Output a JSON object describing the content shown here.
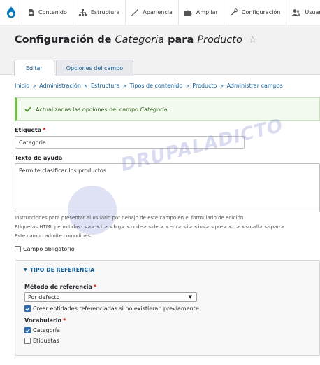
{
  "toolbar": {
    "items": [
      {
        "label": "Contenido",
        "icon": "file-icon"
      },
      {
        "label": "Estructura",
        "icon": "sitemap-icon"
      },
      {
        "label": "Apariencia",
        "icon": "paintbrush-icon"
      },
      {
        "label": "Ampliar",
        "icon": "puzzle-icon"
      },
      {
        "label": "Configuración",
        "icon": "wrench-icon"
      },
      {
        "label": "Usuario",
        "icon": "people-icon"
      }
    ],
    "brand_color": "#0678be"
  },
  "header": {
    "title_prefix": "Configuración de",
    "title_field": "Categoria",
    "title_middle": "para",
    "title_entity": "Producto",
    "star": "☆",
    "tabs": [
      {
        "label": "Editar",
        "active": true
      },
      {
        "label": "Opciones del campo",
        "active": false
      }
    ]
  },
  "breadcrumb": {
    "items": [
      "Inicio",
      "Administración",
      "Estructura",
      "Tipos de contenido",
      "Producto",
      "Administrar campos"
    ],
    "separator": "»"
  },
  "status": {
    "text": "Actualizadas las opciones del campo",
    "field": "Categoria",
    "suffix": ".",
    "color": "#72bd4a"
  },
  "form": {
    "label_field": {
      "label": "Etiqueta",
      "required_marker": "*",
      "value": "Categoria"
    },
    "help_field": {
      "label": "Texto de ayuda",
      "value": "Permite clasificar los productos"
    },
    "help_desc_1": "Instrucciones para presentar al usuario por debajo de este campo en el formulario de edición.",
    "help_desc_2": "Etiquetas HTML permitidas: <a> <b> <big> <code> <del> <em> <i> <ins> <pre> <q> <small> <span>",
    "help_desc_3": "Este campo admite comodines.",
    "required_checkbox": {
      "label": "Campo obligatorio",
      "checked": false
    }
  },
  "reference": {
    "legend": "TIPO DE REFERENCIA",
    "method_label": "Método de referencia",
    "required_marker": "*",
    "method_value": "Por defecto",
    "create_checkbox": {
      "label": "Crear entidades referenciadas si no existieran previamente",
      "checked": true
    },
    "vocab_label": "Vocabulario",
    "vocab_required_marker": "*",
    "vocabularies": [
      {
        "label": "Categoría",
        "checked": true
      },
      {
        "label": "Etiquetas",
        "checked": false
      }
    ]
  },
  "watermark": {
    "text": "DRUPALADICTO"
  }
}
